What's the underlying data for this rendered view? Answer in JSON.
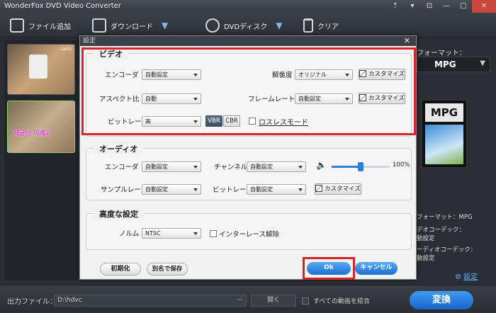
{
  "window": {
    "title": "WonderFox DVD Video Converter",
    "buttons": [
      "⇡",
      "▾",
      "⊡",
      "—",
      "□",
      "✕"
    ]
  },
  "toolbar": {
    "add_file": "ファイル追加",
    "download": "ダウンロード",
    "dvd_disc": "DVDディスク",
    "clear": "クリア"
  },
  "right_panel": {
    "output_format_label": "フォーマット：",
    "format_selected": "MPG",
    "format_card": "MPG",
    "info_format": "フォーマット：MPG",
    "info_video_codec_label": "デオコーデック：",
    "info_video_codec_value": "動設定",
    "info_audio_codec_label": "ーディオコーデック：",
    "info_audio_codec_value": "動設定",
    "settings_link": "設定"
  },
  "thumbs": {
    "overlay_1": "LaSS",
    "overlay_2": "세균이 미래고"
  },
  "dialog": {
    "title": "設定",
    "close": "✕",
    "video": {
      "heading": "ビデオ",
      "encoder_label": "エンコーダ",
      "encoder_value": "自動設定",
      "resolution_label": "解像度",
      "resolution_value": "オリジナル",
      "aspect_label": "アスペクト比",
      "aspect_value": "自動",
      "framerate_label": "フレームレート",
      "framerate_value": "自動設定",
      "bitrate_label": "ビットレート",
      "bitrate_value": "高",
      "vbr": "VBR",
      "cbr": "CBR",
      "lossless_label": "ロスレスモード",
      "customize": "カスタマイズ"
    },
    "audio": {
      "heading": "オーディオ",
      "encoder_label": "エンコーダ",
      "encoder_value": "自動設定",
      "channel_label": "チャンネル",
      "channel_value": "自動設定",
      "volume_value": "100%",
      "volume_level": 0.5,
      "samplerate_label": "サンプルレート",
      "samplerate_value": "自動設定",
      "bitrate_label": "ビットレート",
      "bitrate_value": "自動設定",
      "customize": "カスタマイズ"
    },
    "advanced": {
      "heading": "高度な設定",
      "norm_label": "ノルム",
      "norm_value": "NTSC",
      "deinterlace_label": "インターレース解除"
    },
    "reset": "初期化",
    "save_as": "別名で保存",
    "ok": "Ok",
    "cancel": "キャンセル"
  },
  "bottom": {
    "output_label": "出力ファイル：",
    "output_path": "D:\\hdvc",
    "browse": "···",
    "open": "開く",
    "merge_label": "すべての動画を結合",
    "convert": "変換"
  },
  "colors": {
    "accent_blue": "#2f7fd8",
    "highlight_red": "#d6252c",
    "dark_bg": "#2b2f35"
  }
}
